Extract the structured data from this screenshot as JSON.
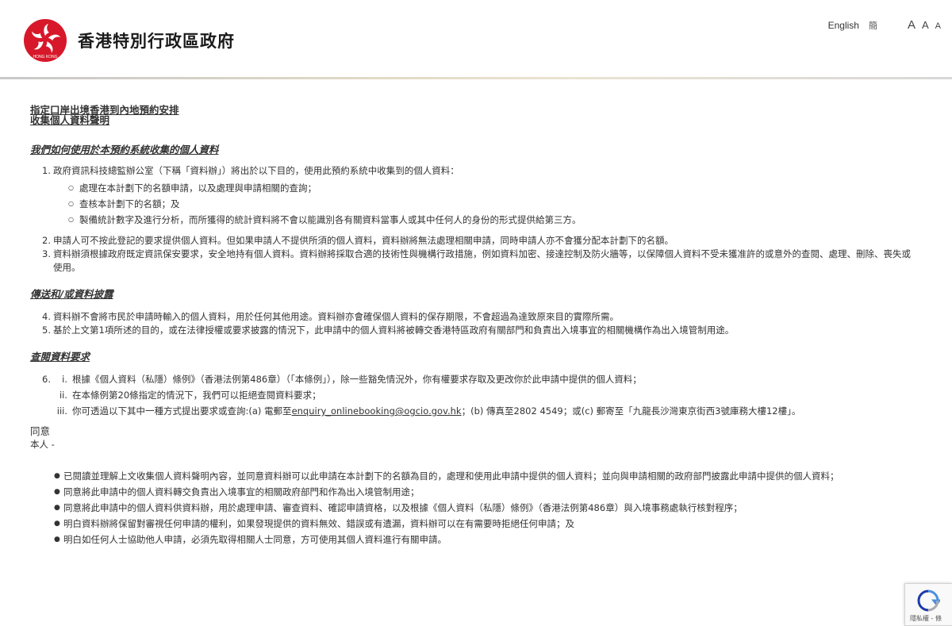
{
  "header": {
    "logo_text": "HONG KONG",
    "gov_name": "香港特別行政區政府",
    "lang_en": "English",
    "lang_sc": "簡",
    "font_large": "A",
    "font_medium": "A",
    "font_small": "A"
  },
  "title": {
    "line1": "指定口岸出境香港到內地預約安排",
    "line2": "收集個人資料聲明"
  },
  "section1": {
    "heading": "我們如何使用於本預約系統收集的個人資料",
    "items": [
      {
        "num": "1.",
        "text": "政府資訊科技總監辦公室（下稱「資料辦」）將出於以下目的，使用此預約系統中收集到的個人資料：",
        "subs": [
          "處理在本計劃下的名額申請，以及處理與申請相關的查詢；",
          "查核本計劃下的名額；及",
          "製備統計數字及進行分析，而所獲得的統計資料將不會以能識別各有關資料當事人或其中任何人的身份的形式提供給第三方。"
        ]
      },
      {
        "num": "2.",
        "text": "申請人可不按此登記的要求提供個人資料。但如果申請人不提供所須的個人資料，資料辦將無法處理相關申請，同時申請人亦不會獲分配本計劃下的名額。"
      },
      {
        "num": "3.",
        "text": "資料辦須根據政府既定資訊保安要求，安全地持有個人資料。資料辦將採取合適的技術性與機構行政措施，例如資料加密、接達控制及防火牆等，以保障個人資料不受未獲准許的或意外的查閱、處理、刪除、喪失或使用。"
      }
    ]
  },
  "section2": {
    "heading": "傳送和/或資料披露",
    "items": [
      {
        "num": "4.",
        "text": "資料辦不會將市民於申請時輸入的個人資料，用於任何其他用途。資料辦亦會確保個人資料的保存期限，不會超過為達致原來目的實際所需。"
      },
      {
        "num": "5.",
        "text": "基於上文第1項所述的目的，或在法律授權或要求披露的情況下，此申請中的個人資料將被轉交香港特區政府有關部門和負責出入境事宜的相關機構作為出入境管制用途。"
      }
    ]
  },
  "section3": {
    "heading": "查閱資料要求",
    "num": "6.",
    "items": [
      {
        "rn": "i.",
        "text": "根據《個人資料（私隱）條例》（香港法例第486章）（「本條例」），除一些豁免情況外，你有權要求存取及更改你於此申請中提供的個人資料；"
      },
      {
        "rn": "ii.",
        "text": "在本條例第20條指定的情況下，我們可以拒絕查閱資料要求；"
      }
    ],
    "item3": {
      "rn": "iii.",
      "before": "你可透過以下其中一種方式提出要求或查詢:(a) 電郵至",
      "email": "enquiry_onlinebooking@ogcio.gov.hk",
      "after": "；(b) 傳真至2802 4549；或(c) 郵寄至「九龍長沙灣東京街西3號庫務大樓12樓」。"
    }
  },
  "consent": {
    "heading": "同意",
    "subheading": "本人 -",
    "items": [
      "已閱讀並理解上文收集個人資料聲明內容，並同意資料辦可以此申請在本計劃下的名額為目的，處理和使用此申請中提供的個人資料；並向與申請相關的政府部門披露此申請中提供的個人資料；",
      "同意將此申請中的個人資料轉交負責出入境事宜的相關政府部門和作為出入境管制用途；",
      "同意將此申請中的個人資料供資料辦，用於處理申請、審查資料、確認申請資格，以及根據《個人資料（私隱）條例》（香港法例第486章）與入境事務處執行核對程序；",
      "明白資料辦將保留對審視任何申請的權利，如果發現提供的資料無效、錯誤或有遺漏，資料辦可以在有需要時拒絕任何申請；及",
      "明白如任何人士協助他人申請，必須先取得相關人士同意，方可使用其個人資料進行有關申請。"
    ]
  },
  "recaptcha": {
    "text": "隱私權 - 條"
  }
}
